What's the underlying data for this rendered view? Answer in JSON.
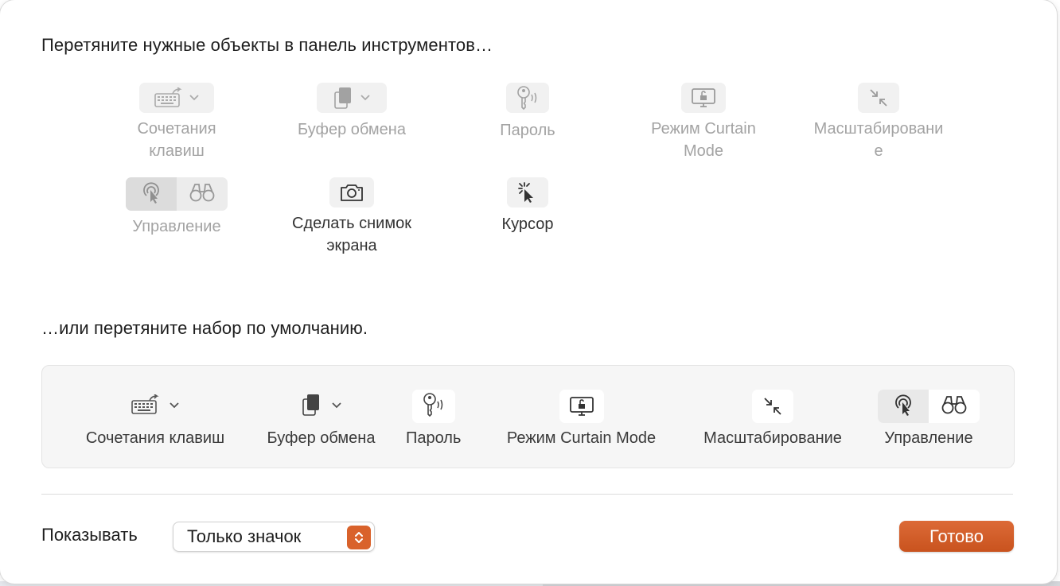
{
  "window": {
    "heading_items": "Перетяните нужные объекты в панель инструментов…",
    "heading_default": "…или перетяните набор по умолчанию."
  },
  "palette": {
    "shortcuts": {
      "label_line1": "Сочетания",
      "label_line2": "клавиш",
      "icon": "keyboard-arrow-icon"
    },
    "clipboard": {
      "label": "Буфер обмена",
      "icon": "clipboard-icon"
    },
    "password": {
      "label": "Пароль",
      "icon": "key-icon"
    },
    "curtain": {
      "label_line1": "Режим Curtain",
      "label_line2": "Mode",
      "icon": "display-lock-icon"
    },
    "scale": {
      "label_line1": "Масштабировани",
      "label_line2": "е",
      "icon": "arrows-inward-icon"
    },
    "control": {
      "label": "Управление",
      "icons": [
        "pointer-cursor-icon",
        "binoculars-icon"
      ]
    },
    "screenshot": {
      "label_line1": "Сделать снимок",
      "label_line2": "экрана",
      "icon": "camera-icon"
    },
    "cursor": {
      "label": "Курсор",
      "icon": "cursor-sparkle-icon"
    }
  },
  "default_set": {
    "items": [
      {
        "label": "Сочетания клавиш",
        "icon": "keyboard-arrow-icon"
      },
      {
        "label": "Буфер обмена",
        "icon": "clipboard-icon"
      },
      {
        "label": "Пароль",
        "icon": "key-icon"
      },
      {
        "label": "Режим Curtain Mode",
        "icon": "display-lock-icon"
      },
      {
        "label": "Масштабирование",
        "icon": "arrows-inward-icon"
      },
      {
        "label": "Управление",
        "icon": "pointer-cursor-icon"
      }
    ]
  },
  "footer": {
    "show_label": "Показывать",
    "show_value": "Только значок",
    "done_label": "Готово"
  },
  "colors": {
    "accent": "#d9622b",
    "label_inactive": "#a3a3a3",
    "label_active": "#333333"
  }
}
